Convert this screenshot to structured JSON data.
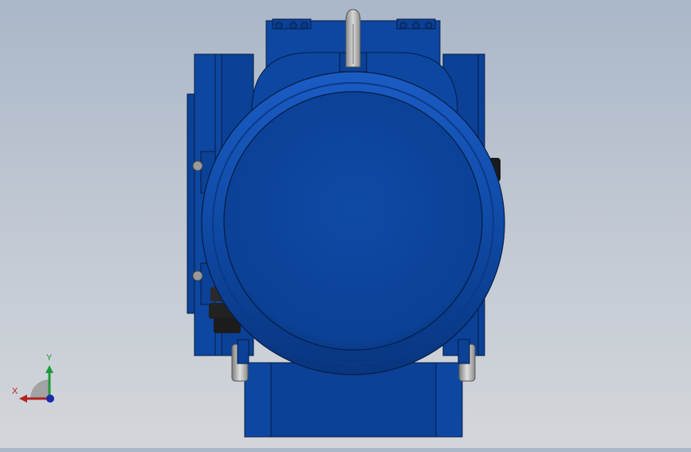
{
  "viewport": {
    "background_top": "#aab7c8",
    "background_bottom": "#d3d6da"
  },
  "model": {
    "body_color": "#0d47a1",
    "body_dark": "#083479",
    "edge_color": "#061d44",
    "lifting_eye_color": "#a8a8a8",
    "foot_pad_color": "#bfbfbf",
    "terminal_color": "#2a2a2a"
  },
  "triad": {
    "x_label": "X",
    "y_label": "Y",
    "x_color": "#b22222",
    "y_color": "#1f9a3a",
    "z_color": "#1a2aa8"
  }
}
